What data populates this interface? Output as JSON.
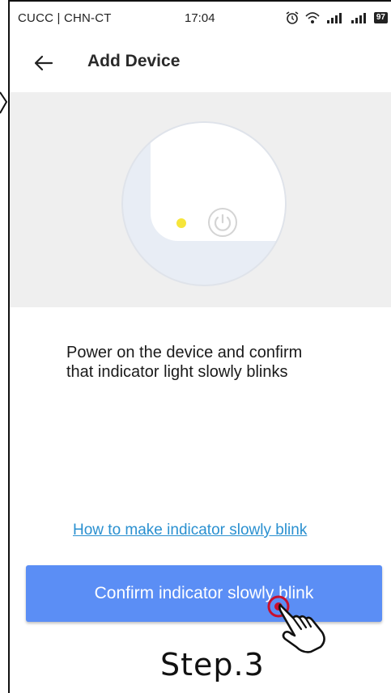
{
  "status_bar": {
    "carrier": "CUCC | CHN-CT",
    "time": "17:04",
    "icons": [
      "alarm-icon",
      "wifi-icon",
      "signal-icon",
      "signal-icon",
      "battery-icon"
    ],
    "battery_level": "97"
  },
  "header": {
    "back_icon": "arrow-left-icon",
    "title": "Add Device"
  },
  "illustration": {
    "indicator_color": "#f6e53a",
    "icon": "power-icon"
  },
  "instruction": {
    "line1": "Power on the device and confirm",
    "line2": "that indicator light slowly blinks"
  },
  "help_link": "How to make indicator slowly blink",
  "confirm_button": {
    "label": "Confirm indicator slowly blink",
    "color": "#5b8ef5"
  },
  "annotation": {
    "hand_icon": "tap-hand-icon",
    "step": "Step.3"
  }
}
